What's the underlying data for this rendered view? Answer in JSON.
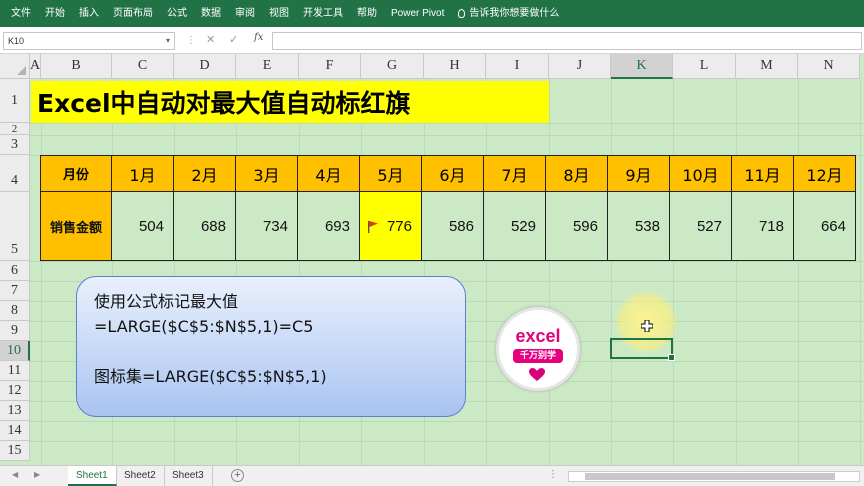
{
  "ribbon": {
    "tabs": [
      "文件",
      "开始",
      "插入",
      "页面布局",
      "公式",
      "数据",
      "审阅",
      "视图",
      "开发工具",
      "帮助",
      "Power Pivot"
    ],
    "tell_me": "告诉我你想要做什么"
  },
  "formula_bar": {
    "name_box": "K10",
    "formula": ""
  },
  "columns": [
    "A",
    "B",
    "C",
    "D",
    "E",
    "F",
    "G",
    "H",
    "I",
    "J",
    "K",
    "L",
    "M",
    "N"
  ],
  "selected_column": "K",
  "rows": [
    "1",
    "2",
    "3",
    "4",
    "5",
    "6",
    "7",
    "8",
    "9",
    "10",
    "11",
    "12",
    "13",
    "14",
    "15"
  ],
  "selected_row": "10",
  "title": "Excel中自动对最大值自动标红旗",
  "table": {
    "header_label": "月份",
    "months": [
      "1月",
      "2月",
      "3月",
      "4月",
      "5月",
      "6月",
      "7月",
      "8月",
      "9月",
      "10月",
      "11月",
      "12月"
    ],
    "data_label": "销售金额",
    "values": [
      "504",
      "688",
      "734",
      "693",
      "776",
      "586",
      "529",
      "596",
      "538",
      "527",
      "718",
      "664"
    ],
    "highlight_color": "#ffff00",
    "header_color": "#ffc000",
    "flag_icon": "red-flag-icon"
  },
  "note": {
    "line1": "使用公式标记最大值",
    "line2": "=LARGE($C$5:$N$5,1)=C5",
    "line3": "图标集=LARGE($C$5:$N$5,1)"
  },
  "logo": {
    "text": "excel",
    "subtext": "千万别学"
  },
  "sheets": [
    "Sheet1",
    "Sheet2",
    "Sheet3"
  ],
  "active_sheet": "Sheet1",
  "colors": {
    "ribbon": "#217346",
    "grid_background": "#cce9c6",
    "accent": "#217346"
  }
}
